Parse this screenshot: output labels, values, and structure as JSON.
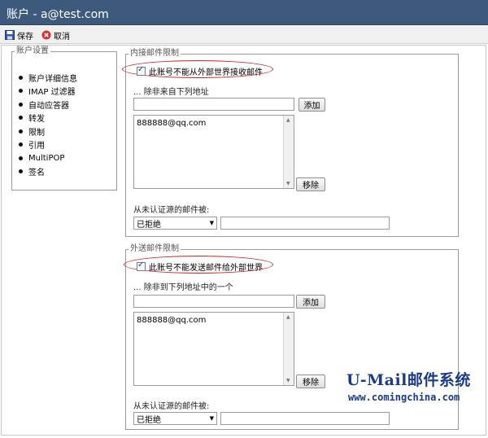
{
  "window": {
    "title": "账户 - a@test.com"
  },
  "toolbar": {
    "save_label": "保存",
    "cancel_label": "取消"
  },
  "nav": {
    "legend": "账户设置",
    "items": [
      "账户详细信息",
      "IMAP 过滤器",
      "自动应答器",
      "转发",
      "限制",
      "引用",
      "MultiPOP",
      "签名"
    ]
  },
  "incoming": {
    "legend": "内接邮件限制",
    "checkbox_label": "此账号不能从外部世界接收邮件",
    "checked": true,
    "except_label": "... 除非来自下列地址",
    "add_label": "添加",
    "list_items": [
      "888888@qq.com"
    ],
    "remove_label": "移除",
    "unauth_label": "从未认证源的邮件被:",
    "unauth_value": "已拒绝",
    "extra_value": ""
  },
  "outgoing": {
    "legend": "外送邮件限制",
    "checkbox_label": "此账号不能发送邮件给外部世界",
    "checked": true,
    "except_label": "... 除非到下列地址中的一个",
    "add_label": "添加",
    "list_items": [
      "888888@qq.com"
    ],
    "remove_label": "移除",
    "unauth_label": "从未认证源的邮件被:",
    "unauth_value": "已拒绝",
    "extra_value": ""
  },
  "watermark": {
    "brand": "U-Mail邮件系统",
    "url": "www.comingchina.com"
  },
  "colors": {
    "titlebar": "#3d5a7c",
    "highlight_oval": "#cc2222",
    "watermark": "#1a3a8a"
  }
}
